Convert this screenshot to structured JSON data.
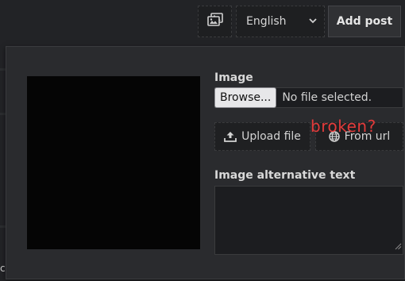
{
  "topbar": {
    "media_icon": "images-icon",
    "language": {
      "selected": "English"
    },
    "add_post_label": "Add post"
  },
  "background": {
    "partial_char": "c"
  },
  "image_panel": {
    "image_label": "Image",
    "file_input": {
      "button_label": "Browse...",
      "status": "No file selected."
    },
    "upload_file_label": "Upload file",
    "from_url_label": "From url",
    "overlay_note": "broken?",
    "alt_text_label": "Image alternative text",
    "alt_text_value": ""
  },
  "colors": {
    "page_bg": "#222326",
    "panel_bg": "#2a2b2e",
    "preview_bg": "#050505",
    "note_red": "#e23a3a"
  }
}
